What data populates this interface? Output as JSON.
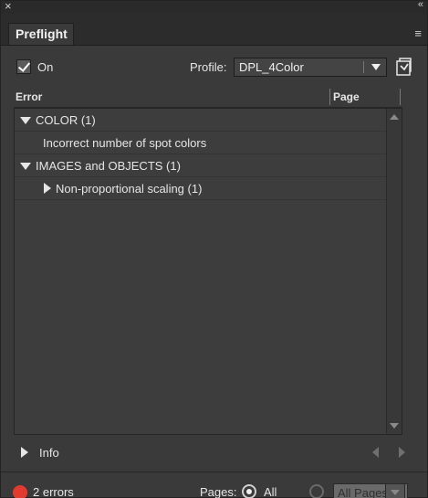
{
  "window": {
    "close_glyph": "×",
    "collapse_glyph": "«"
  },
  "tab": {
    "label": "Preflight",
    "menu_glyph": "≡"
  },
  "toolbar": {
    "on_label": "On",
    "on_checked": true,
    "profile_label": "Profile:",
    "profile_value": "DPL_4Color"
  },
  "table": {
    "header_error": "Error",
    "header_page": "Page",
    "rows": [
      {
        "text": "COLOR (1)",
        "expand": "down"
      },
      {
        "text": "Incorrect number of spot colors",
        "expand": "none"
      },
      {
        "text": "IMAGES and OBJECTS (1)",
        "expand": "down"
      },
      {
        "text": "Non-proportional scaling (1)",
        "expand": "right"
      }
    ]
  },
  "info": {
    "label": "Info"
  },
  "status": {
    "error_color": "#e23a2f",
    "errors_text": "2 errors",
    "pages_label": "Pages:",
    "all_label": "All",
    "range_value": "All Pages"
  }
}
